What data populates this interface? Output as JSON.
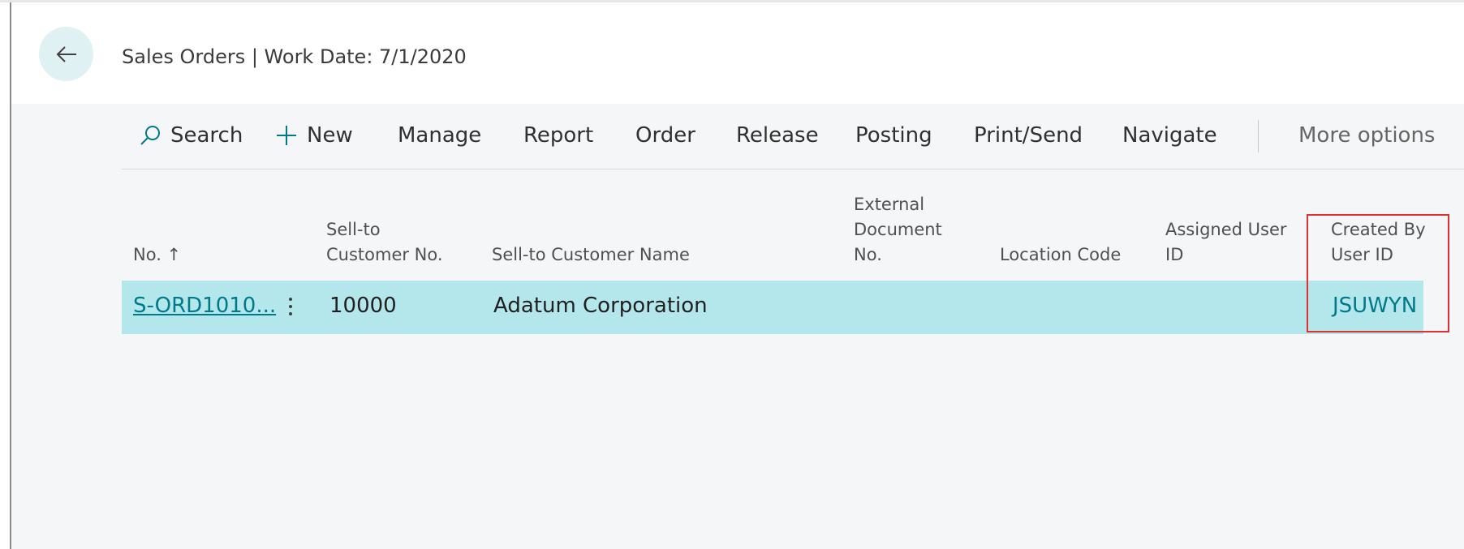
{
  "page": {
    "title": "Sales Orders | Work Date: 7/1/2020"
  },
  "icons": {
    "back": "back-arrow-icon",
    "search": "search-icon",
    "new": "plus-icon",
    "row_menu": "more-vertical-icon"
  },
  "colors": {
    "selected_row": "#b3e7ec",
    "link": "#007a89",
    "highlight": "#e03131"
  },
  "action_bar": {
    "search": "Search",
    "new": "New",
    "manage": "Manage",
    "report": "Report",
    "order": "Order",
    "release": "Release",
    "posting": "Posting",
    "print_send": "Print/Send",
    "navigate": "Navigate",
    "more": "More options"
  },
  "table": {
    "columns": [
      "No. ↑",
      "Sell-to\nCustomer No.",
      "Sell-to Customer Name",
      "External\nDocument\nNo.",
      "Location Code",
      "Assigned User\nID",
      "Created By\nUser ID"
    ],
    "rows": [
      {
        "no": "S-ORD1010...",
        "customer_no": "10000",
        "customer_name": "Adatum Corporation",
        "external_doc_no": "",
        "location_code": "",
        "assigned_user_id": "",
        "created_by_user_id": "JSUWYN"
      }
    ]
  }
}
